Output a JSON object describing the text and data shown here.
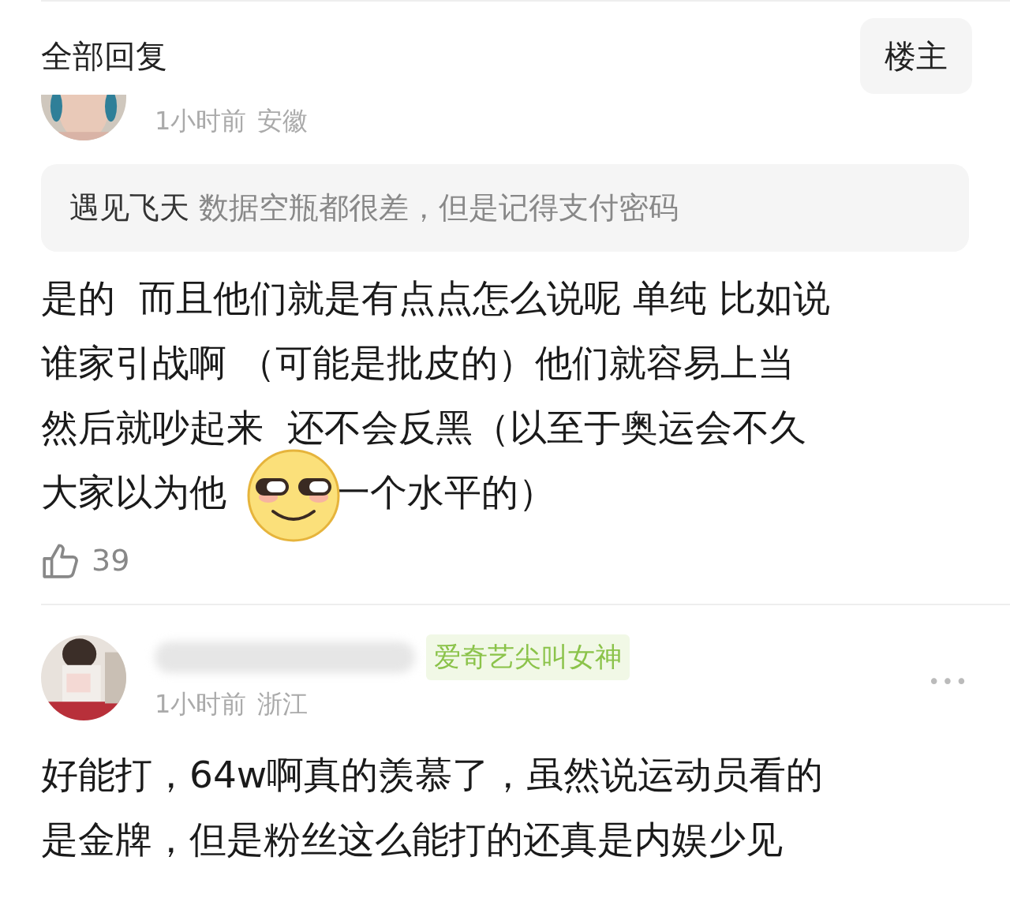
{
  "header": {
    "title": "全部回复",
    "filter_button": "楼主"
  },
  "comments": [
    {
      "avatar": {
        "kind": "picture"
      },
      "cut_top": true,
      "name_hidden": false,
      "time": "1小时前",
      "location": "安徽",
      "quote": {
        "author": "遇见飞天",
        "text": "数据空瓶都很差，但是记得支付密码"
      },
      "lines": [
        [
          {
            "text": "是的  而且他们就是有点点怎么说呢 单纯 比如说"
          }
        ],
        [
          {
            "text": "谁家引战啊 （可能是批皮的）他们就容易上当"
          }
        ],
        [
          {
            "text": "然后就吵起来  还不会反黑（以至于奥运会不久"
          }
        ],
        [
          {
            "text": "大家以为他"
          },
          {
            "kind": "sticker"
          },
          {
            "text": "一个水平的）"
          }
        ]
      ],
      "likes": "39"
    },
    {
      "avatar": {
        "kind": "picture"
      },
      "cut_top": false,
      "name_hidden": true,
      "badge": "爱奇艺尖叫女神",
      "more": "•••",
      "time": "1小时前",
      "location": "浙江",
      "lines": [
        [
          {
            "text": "好能打，64w啊真的羡慕了，虽然说运动员看的"
          }
        ],
        [
          {
            "text": "是金牌，但是粉丝这么能打的还真是内娱少见"
          }
        ]
      ]
    }
  ]
}
